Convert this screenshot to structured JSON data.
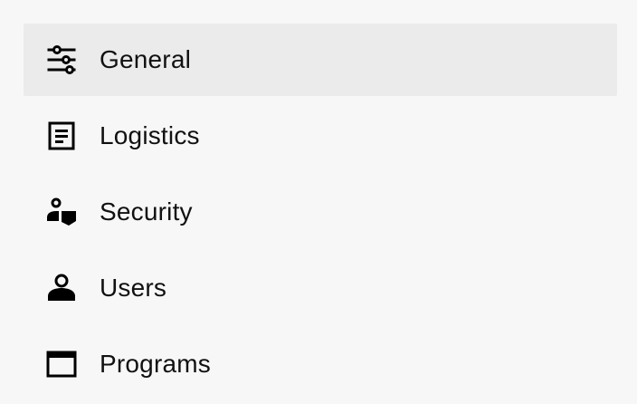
{
  "sidebar": {
    "items": [
      {
        "label": "General",
        "icon": "sliders-icon",
        "active": true
      },
      {
        "label": "Logistics",
        "icon": "document-icon",
        "active": false
      },
      {
        "label": "Security",
        "icon": "user-shield-icon",
        "active": false
      },
      {
        "label": "Users",
        "icon": "person-icon",
        "active": false
      },
      {
        "label": "Programs",
        "icon": "window-icon",
        "active": false
      }
    ]
  },
  "colors": {
    "background": "#f7f7f7",
    "active_item_background": "#ebebeb",
    "text": "#111111"
  }
}
